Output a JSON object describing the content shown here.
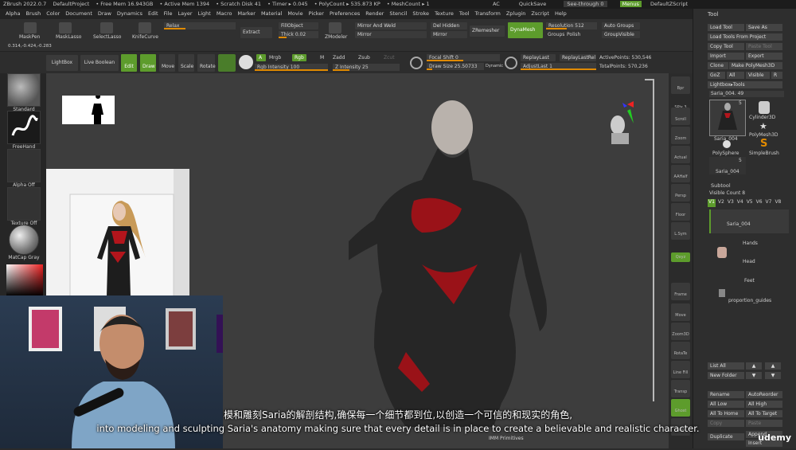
{
  "titlebar": {
    "app": "ZBrush 2022.0.7",
    "project": "DefaultProject",
    "free_mem": "• Free Mem 16.943GB",
    "active_mem": "• Active Mem 1394",
    "scratch": "• Scratch Disk 41",
    "timer": "• Timer ▸ 0.045",
    "polycount": "• PolyCount ▸ 535.873 KP",
    "meshcount": "• MeshCount ▸ 1",
    "ac": "AC",
    "quicksave": "QuickSave",
    "seethrough": "See-through  0",
    "menus": "Menus",
    "zscript": "DefaultZScript"
  },
  "menu": [
    "Alpha",
    "Brush",
    "Color",
    "Document",
    "Draw",
    "Dynamics",
    "Edit",
    "File",
    "Layer",
    "Light",
    "Macro",
    "Marker",
    "Material",
    "Movie",
    "Picker",
    "Preferences",
    "Render",
    "Stencil",
    "Stroke",
    "Texture",
    "Tool",
    "Transform",
    "Zplugin",
    "Zscript",
    "Help"
  ],
  "shelf": {
    "coords": "0.314,-0.424,-0.283",
    "masksel": "MaskPen",
    "masklasso": "MaskLasso",
    "selectlasso": "SelectLasso",
    "knifecurve": "KnifeCurve",
    "relax": "Relax",
    "extract": "Extract",
    "fillobject": "FillObject",
    "thick": "Thick 0.02",
    "zmodeler": "ZModeler",
    "mirrorweld": "Mirror And Weld",
    "mirror": "Mirror",
    "delhidden": "Del Hidden",
    "mirror2": "Mirror",
    "zremesher": "ZRemesher",
    "dynamesh": "DynaMesh",
    "resolution": "Resolution 512",
    "groups": "Groups",
    "polish": "Polish",
    "autogroups": "Auto Groups",
    "groupvisible": "GroupVisible",
    "lightbox": "LightBox",
    "liveboolean": "Live Boolean",
    "edit": "Edit",
    "draw": "Draw",
    "move": "Move",
    "scale": "Scale",
    "rotate": "Rotate",
    "a": "A",
    "mrgb": "Mrgb",
    "rgb": "Rgb",
    "m": "M",
    "zadd": "Zadd",
    "zsub": "Zsub",
    "zcut": "Zcut",
    "rgbintensity": "Rgb Intensity 100",
    "zintensity": "Z Intensity 25",
    "focalshift": "Focal Shift 0",
    "drawsize": "Draw Size 25.50733",
    "dynamic": "Dynamic",
    "replaylast": "ReplayLast",
    "replaylastrel": "ReplayLastRel",
    "adjustlast": "AdjustLast 1",
    "activepoints": "ActivePoints: 530,546",
    "totalpoints": "TotalPoints: 570,236"
  },
  "leftpanel": {
    "standard": "Standard",
    "freehand": "FreeHand",
    "alphaoff": "Alpha Off",
    "textureoff": "Texture Off",
    "matcap": "MatCap Gray"
  },
  "rightshelf": [
    "Bpr",
    "SPix 3",
    "Scroll",
    "Zoom",
    "Actual",
    "AAHalf",
    "Persp",
    "Floor",
    "L.Sym",
    "Qxyz",
    "Frame",
    "Move",
    "Zoom3D",
    "RotaTe",
    "Line Fill",
    "Transp",
    "Ghost",
    "Solo"
  ],
  "toolpanel": {
    "title": "Tool",
    "loadtool": "Load Tool",
    "saveas": "Save As",
    "loadfromproject": "Load Tools From Project",
    "copytool": "Copy Tool",
    "pastetool": "Paste Tool",
    "import": "Import",
    "export": "Export",
    "clone": "Clone",
    "makepolymesh": "Make PolyMesh3D",
    "goz": "GoZ",
    "all": "All",
    "visible": "Visible",
    "r": "R",
    "lightboxtools": "Lightbox▸Tools",
    "current": "Saria_004. 49",
    "tools": [
      "Saria_004",
      "Cylinder3D",
      "PolyMesh3D",
      "PolySphere",
      "SimpleBrush",
      "Saria_004"
    ],
    "count5a": "5",
    "count5b": "5",
    "subtool": "Subtool",
    "visiblecount": "Visible Count 8",
    "versions": [
      "V1",
      "V2",
      "V3",
      "V4",
      "V5",
      "V6",
      "V7",
      "V8"
    ],
    "subtools": [
      "Saria_004",
      "Hands",
      "Head",
      "Feet",
      "proportion_guides"
    ],
    "listall": "List All",
    "newfolder": "New Folder",
    "rename": "Rename",
    "autoreorder": "AutoReorder",
    "alllow": "All Low",
    "allhigh": "All High",
    "alltohome": "All To Home",
    "alltotarget": "All To Target",
    "copy": "Copy",
    "paste": "Paste",
    "duplicate": "Duplicate",
    "append": "Append",
    "insert": "Insert"
  },
  "canvas": {
    "primitives": "IMM Primitives"
  },
  "subtitles": {
    "zh": "模和雕刻Saria的解剖结构,确保每一个细节都到位,以创造一个可信的和现实的角色,",
    "en": "into modeling and sculpting Saria's anatomy making sure that every detail is in place to create a believable and realistic character."
  },
  "watermark": "udemy",
  "colors": {
    "accent_green": "#5d9c2c",
    "accent_orange": "#e08a00",
    "suit_red": "#b3151c",
    "suit_black": "#262626"
  }
}
